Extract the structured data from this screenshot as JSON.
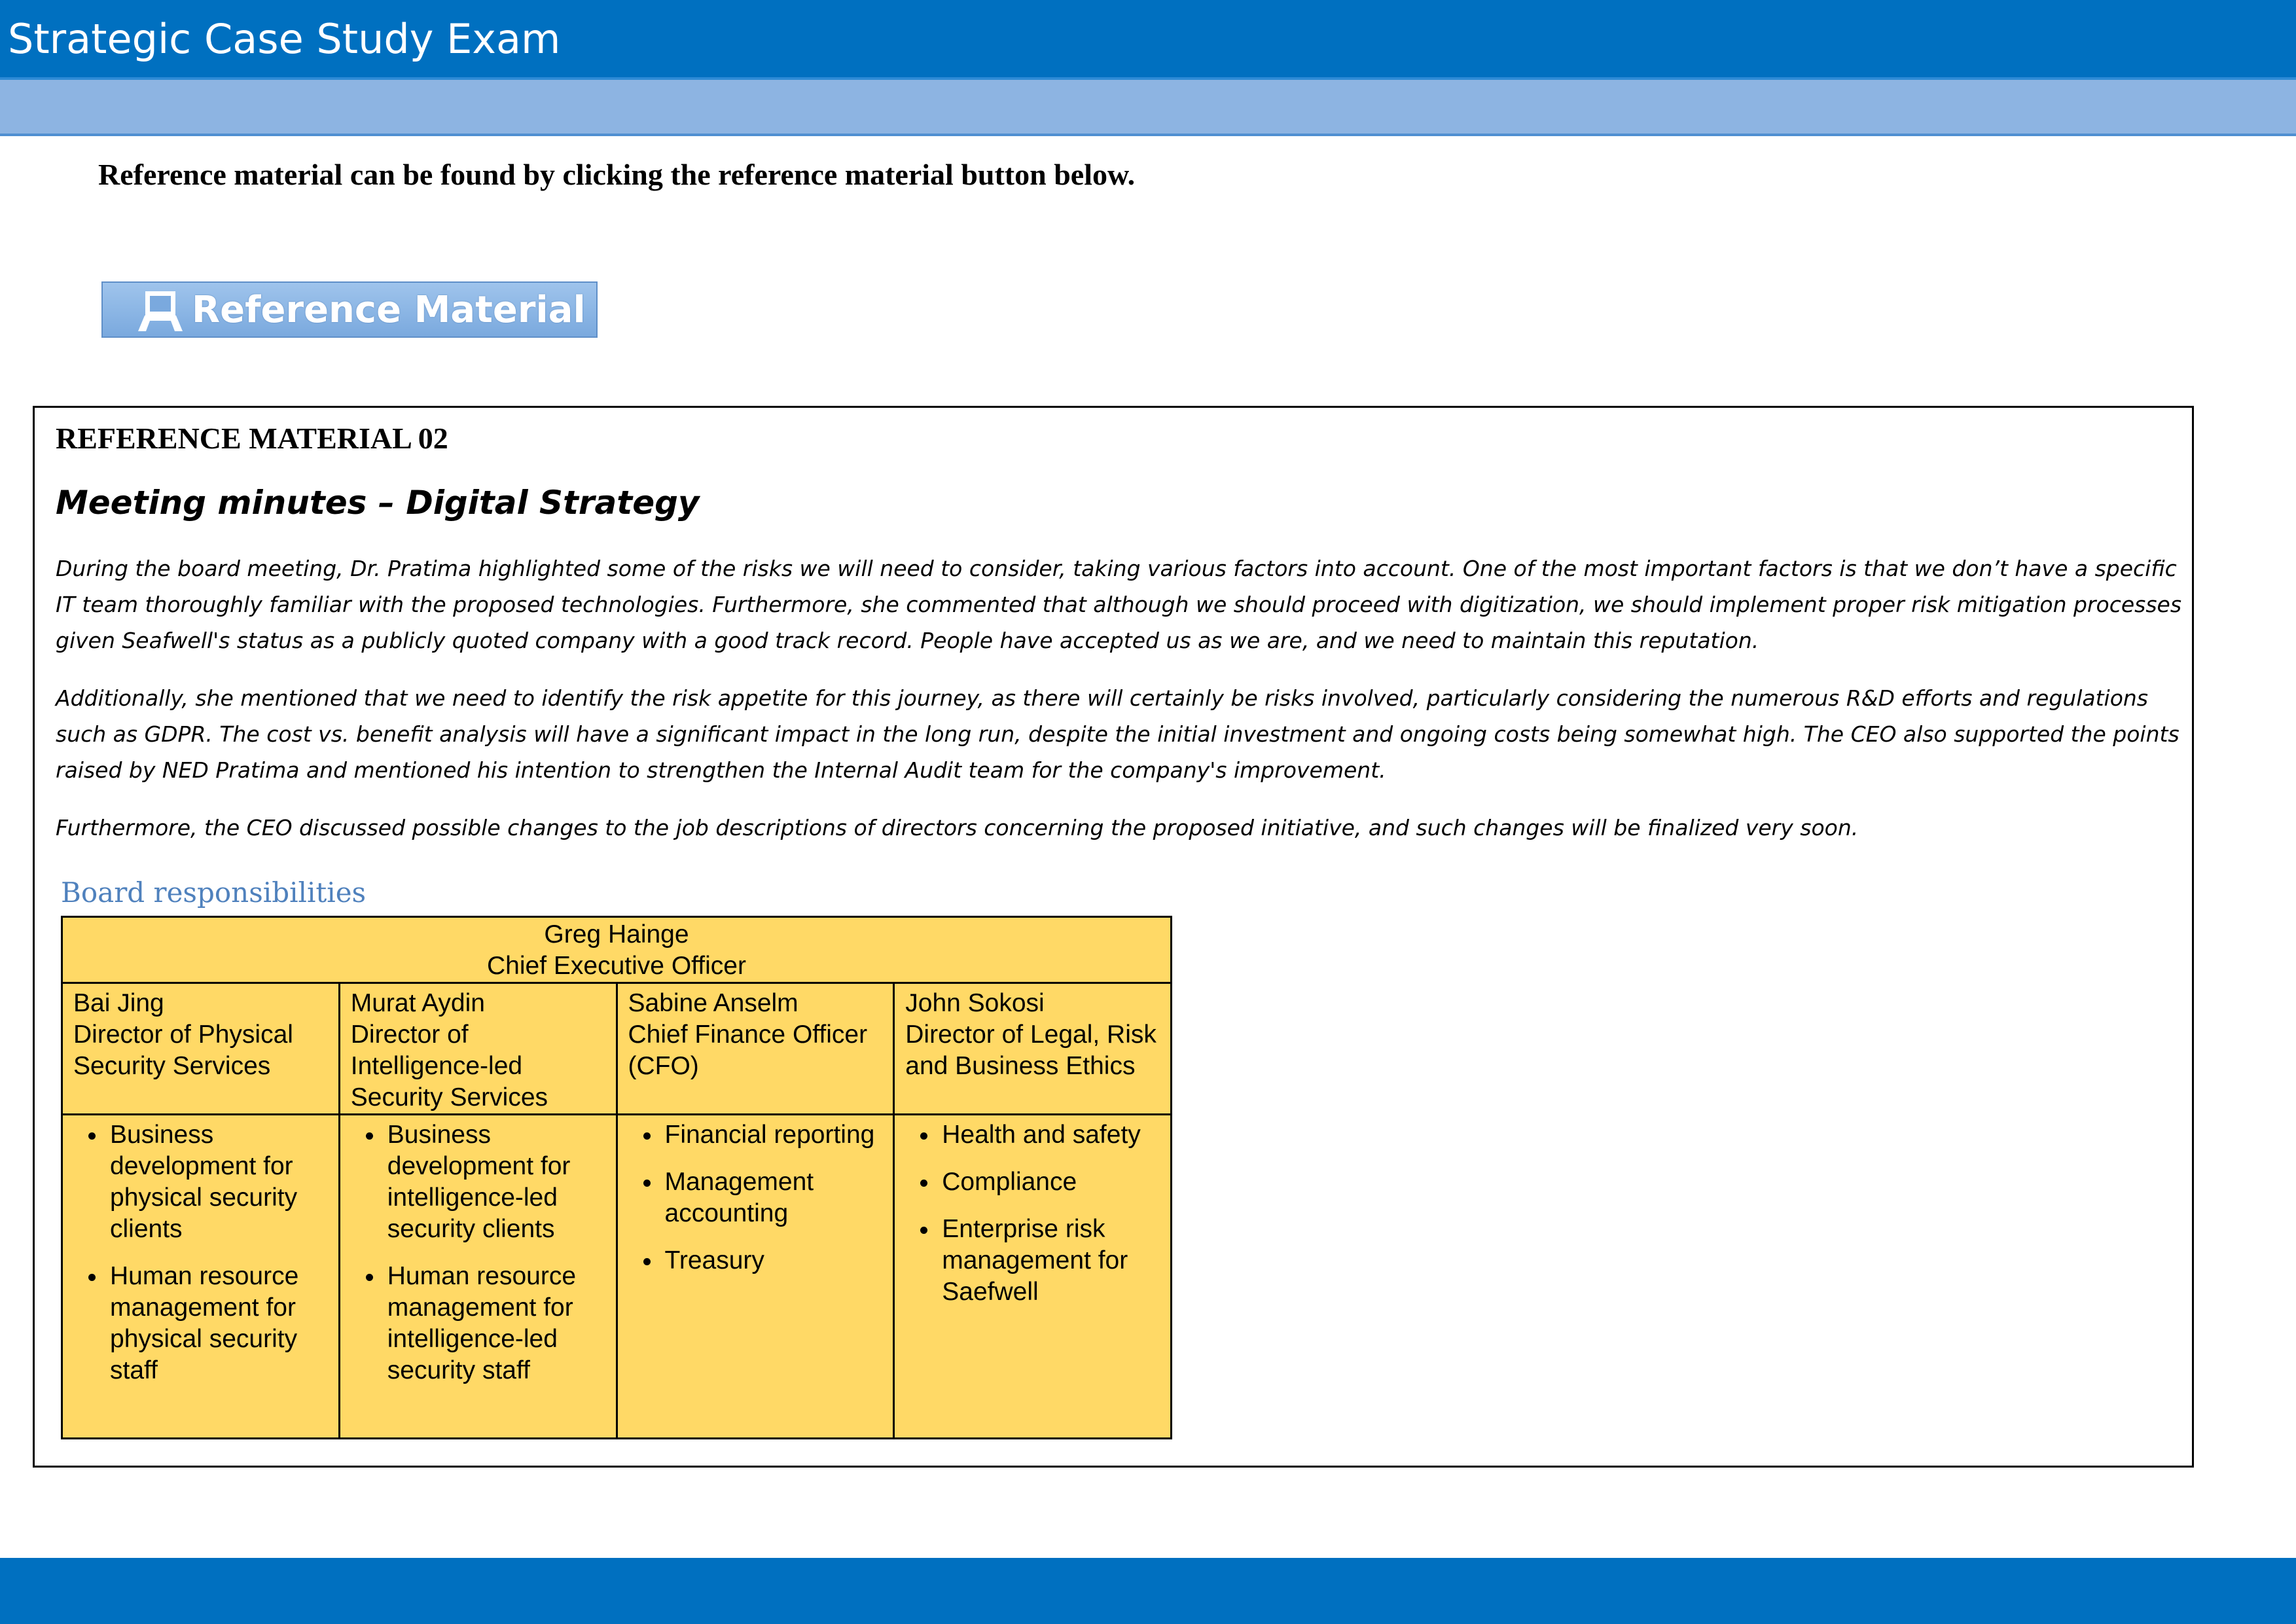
{
  "header": {
    "title": "Strategic Case Study Exam"
  },
  "instruction": "Reference material can be found by clicking the reference material button below.",
  "reference_button": {
    "label": "Reference Material",
    "icon": "document-stand-icon"
  },
  "reference": {
    "heading": "REFERENCE MATERIAL 02",
    "subheading": "Meeting minutes – Digital Strategy",
    "paragraphs": [
      "During the board meeting, Dr. Pratima highlighted some of the risks we will need to consider, taking various factors into account. One of the most important factors is that we don’t have a specific IT team thoroughly familiar with the proposed technologies. Furthermore, she commented that although we should proceed with digitization, we should implement proper risk mitigation processes given Seafwell's status as a publicly quoted company with a good track record. People have accepted us as we are, and we need to maintain this reputation.",
      "Additionally, she mentioned that we need to identify the risk appetite for this journey, as there will certainly be risks involved, particularly considering the numerous R&D efforts and regulations such as GDPR. The cost vs. benefit analysis will have a significant impact in the long run, despite the initial investment and ongoing costs being somewhat high. The CEO also supported the points raised by NED Pratima and mentioned his intention to strengthen the Internal Audit team for the company's improvement.",
      "Furthermore, the CEO discussed possible changes to the job descriptions of directors concerning the proposed initiative, and such changes will be finalized very soon."
    ],
    "board": {
      "caption": "Board responsibilities",
      "ceo_name": "Greg Hainge",
      "ceo_title": "Chief Executive Officer",
      "directors": [
        {
          "name": "Bai Jing",
          "title": "Director of Physical Security Services",
          "duties": [
            "Business development for physical security clients",
            "Human resource management for physical security staff"
          ]
        },
        {
          "name": "Murat Aydin",
          "title": "Director of Intelligence-led Security Services",
          "duties": [
            "Business development for intelligence-led security clients",
            "Human resource management for intelligence-led security staff"
          ]
        },
        {
          "name": "Sabine Anselm",
          "title": "Chief Finance Officer (CFO)",
          "duties": [
            "Financial reporting",
            "Management accounting",
            "Treasury"
          ]
        },
        {
          "name": "John Sokosi",
          "title": "Director of Legal, Risk and Business Ethics",
          "duties": [
            "Health and safety",
            "Compliance",
            "Enterprise risk management for Saefwell"
          ]
        }
      ]
    }
  },
  "colors": {
    "header_blue": "#0070c0",
    "subbar_blue": "#8db4e2",
    "table_yellow": "#ffd966",
    "caption_blue": "#4f81bd"
  }
}
